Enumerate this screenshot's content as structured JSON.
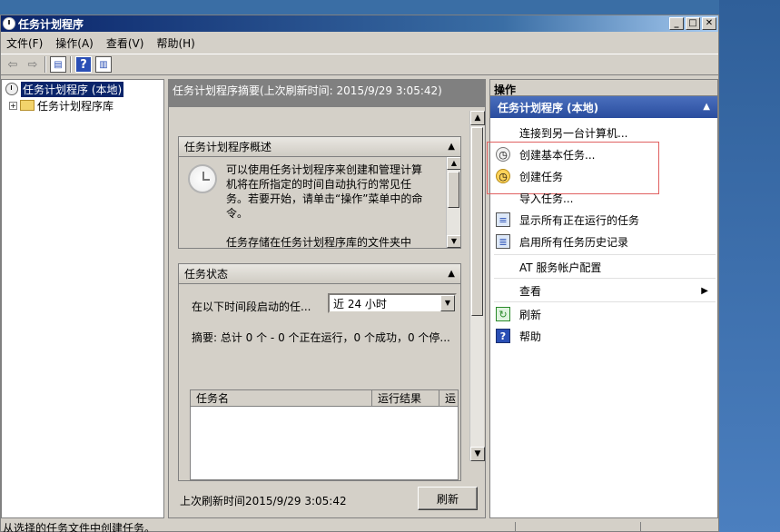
{
  "window": {
    "title": "任务计划程序"
  },
  "menu": [
    "文件(F)",
    "操作(A)",
    "查看(V)",
    "帮助(H)"
  ],
  "tree": {
    "root": "任务计划程序 (本地)",
    "child": "任务计划程序库"
  },
  "middle": {
    "header": "任务计划程序摘要(上次刷新时间: 2015/9/29 3:05:42)",
    "overview": {
      "title": "任务计划程序概述",
      "text": "可以使用任务计划程序来创建和管理计算机将在所指定的时间自动执行的常见任务。若要开始，请单击“操作”菜单中的命令。",
      "text2": "任务存储在任务计划程序库的文件夹中"
    },
    "status": {
      "title": "任务状态",
      "label": "在以下时间段启动的任...",
      "combo_value": "近 24 小时",
      "summary": "摘要: 总计 0 个 - 0 个正在运行，0 个成功，0 个停...",
      "columns": [
        "任务名",
        "运行结果",
        "运"
      ]
    },
    "last_refresh": "上次刷新时间2015/9/29 3:05:42",
    "refresh_button": "刷新"
  },
  "actions": {
    "header": "操作",
    "subheader": "任务计划程序 (本地)",
    "items": [
      {
        "label": "连接到另一台计算机...",
        "icon": "none"
      },
      {
        "label": "创建基本任务...",
        "icon": "clock"
      },
      {
        "label": "创建任务",
        "icon": "clock-star"
      },
      {
        "label": "导入任务...",
        "icon": "none"
      },
      {
        "label": "显示所有正在运行的任务",
        "icon": "list"
      },
      {
        "label": "启用所有任务历史记录",
        "icon": "list"
      },
      {
        "label": "AT 服务帐户配置",
        "icon": "none"
      },
      {
        "label": "查看",
        "icon": "none"
      },
      {
        "label": "刷新",
        "icon": "refresh"
      },
      {
        "label": "帮助",
        "icon": "help"
      }
    ]
  },
  "statusbar": {
    "text": "从选择的任务文件中创建任务。"
  }
}
